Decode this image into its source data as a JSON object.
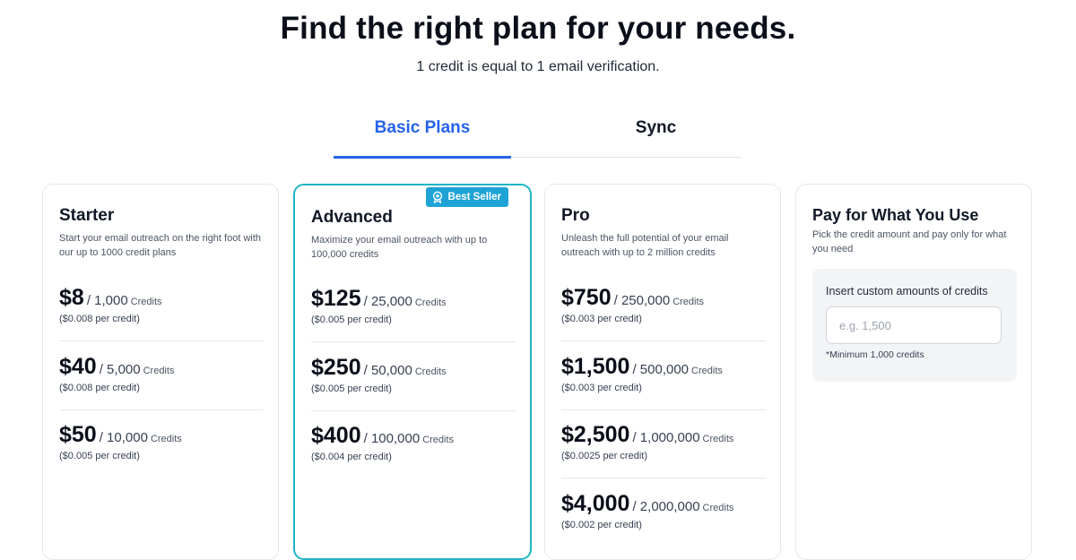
{
  "header": {
    "title": "Find the right plan for your needs.",
    "subtitle": "1 credit is equal to 1 email verification."
  },
  "tabs": [
    {
      "label": "Basic Plans",
      "active": true
    },
    {
      "label": "Sync",
      "active": false
    }
  ],
  "colors": {
    "accent": "#2563eb",
    "highlight_border": "#1fb5c4",
    "badge": "#1fa3d6"
  },
  "plans": [
    {
      "name": "Starter",
      "description": "Start your email outreach on the right foot with our up to 1000 credit plans",
      "tiers": [
        {
          "price": "$8",
          "amount": "/ 1,000",
          "credits_label": "Credits",
          "per": "($0.008 per credit)"
        },
        {
          "price": "$40",
          "amount": "/ 5,000",
          "credits_label": "Credits",
          "per": "($0.008 per credit)"
        },
        {
          "price": "$50",
          "amount": "/ 10,000",
          "credits_label": "Credits",
          "per": "($0.005 per credit)"
        }
      ]
    },
    {
      "name": "Advanced",
      "badge": {
        "label": "Best Seller",
        "icon": "award-icon"
      },
      "description": "Maximize your email outreach with up to 100,000 credits",
      "tiers": [
        {
          "price": "$125",
          "amount": "/ 25,000",
          "credits_label": "Credits",
          "per": "($0.005 per credit)"
        },
        {
          "price": "$250",
          "amount": "/ 50,000",
          "credits_label": "Credits",
          "per": "($0.005 per credit)"
        },
        {
          "price": "$400",
          "amount": "/ 100,000",
          "credits_label": "Credits",
          "per": "($0.004 per credit)"
        }
      ]
    },
    {
      "name": "Pro",
      "description": "Unleash the full potential of your email outreach with up to 2 million credits",
      "tiers": [
        {
          "price": "$750",
          "amount": "/ 250,000",
          "credits_label": "Credits",
          "per": "($0.003 per credit)"
        },
        {
          "price": "$1,500",
          "amount": "/ 500,000",
          "credits_label": "Credits",
          "per": "($0.003 per credit)"
        },
        {
          "price": "$2,500",
          "amount": "/ 1,000,000",
          "credits_label": "Credits",
          "per": "($0.0025 per credit)"
        },
        {
          "price": "$4,000",
          "amount": "/ 2,000,000",
          "credits_label": "Credits",
          "per": "($0.002 per credit)"
        }
      ]
    }
  ],
  "payg": {
    "name": "Pay for What You Use",
    "description": "Pick the credit amount and pay only for what you need",
    "input_label": "Insert custom amounts of credits",
    "input_placeholder": "e.g. 1,500",
    "input_value": "",
    "note": "*Minimum 1,000 credits"
  }
}
